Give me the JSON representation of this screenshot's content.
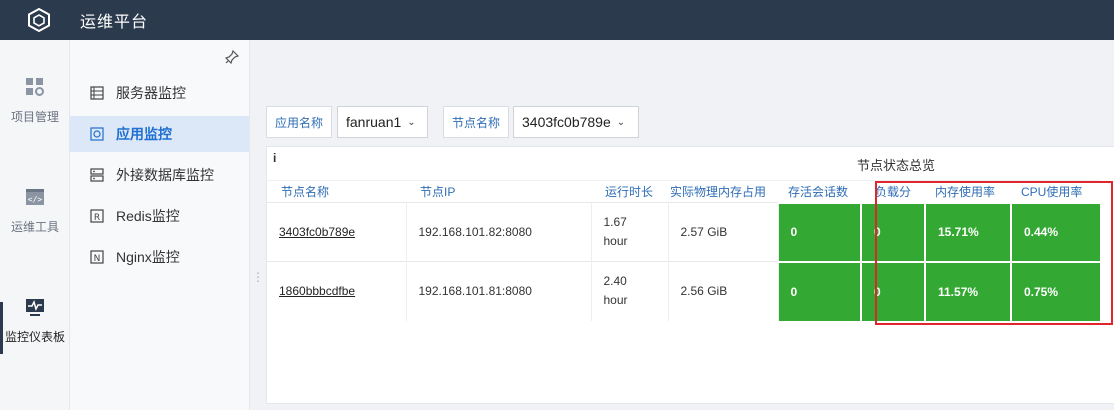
{
  "app": {
    "title": "运维平台"
  },
  "rail": {
    "items": [
      {
        "label": "项目管理",
        "icon": "grid-gear-icon"
      },
      {
        "label": "运维工具",
        "icon": "code-window-icon"
      },
      {
        "label": "监控仪表板",
        "icon": "monitor-icon"
      }
    ]
  },
  "submenu": {
    "items": [
      {
        "label": "服务器监控",
        "icon": "server-list-icon"
      },
      {
        "label": "应用监控",
        "icon": "app-monitor-icon"
      },
      {
        "label": "外接数据库监控",
        "icon": "database-icon"
      },
      {
        "label": "Redis监控",
        "icon": "redis-icon"
      },
      {
        "label": "Nginx监控",
        "icon": "nginx-icon"
      }
    ],
    "active": "应用监控"
  },
  "filters": {
    "app_label": "应用名称",
    "app_value": "fanruan1",
    "node_label": "节点名称",
    "node_value": "3403fc0b789e"
  },
  "panel": {
    "title": "节点状态总览",
    "info_icon": "i",
    "columns": [
      "节点名称",
      "节点IP",
      "运行时长",
      "实际物理内存占用",
      "存活会话数",
      "负载分",
      "内存使用率",
      "CPU使用率"
    ],
    "rows": [
      {
        "name": "3403fc0b789e",
        "ip": "192.168.101.82:8080",
        "uptime_value": "1.67",
        "uptime_unit": "hour",
        "memory": "2.57 GiB",
        "sessions": "0",
        "load": "0",
        "mem_rate": "15.71%",
        "cpu_rate": "0.44%"
      },
      {
        "name": "1860bbbcdfbe",
        "ip": "192.168.101.81:8080",
        "uptime_value": "2.40",
        "uptime_unit": "hour",
        "memory": "2.56 GiB",
        "sessions": "0",
        "load": "0",
        "mem_rate": "11.57%",
        "cpu_rate": "0.75%"
      }
    ]
  },
  "colors": {
    "topbar": "#2b3a4d",
    "status_green": "#33a832",
    "highlight_red": "#e0262c",
    "link_blue": "#2f6db5"
  }
}
